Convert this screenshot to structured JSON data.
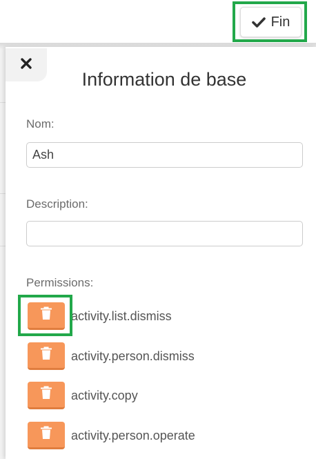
{
  "toolbar": {
    "done_label": "Fin"
  },
  "panel": {
    "title": "Information de base",
    "name_label": "Nom:",
    "name_value": "Ash",
    "description_label": "Description:",
    "description_value": "",
    "permissions_label": "Permissions:",
    "permissions": [
      "activity.list.dismiss",
      "activity.person.dismiss",
      "activity.copy",
      "activity.person.operate"
    ]
  },
  "icons": {
    "done": "check-icon",
    "close": "close-icon",
    "delete": "trash-icon"
  },
  "colors": {
    "highlight": "#22a84a",
    "delete_button": "#f7975a"
  }
}
